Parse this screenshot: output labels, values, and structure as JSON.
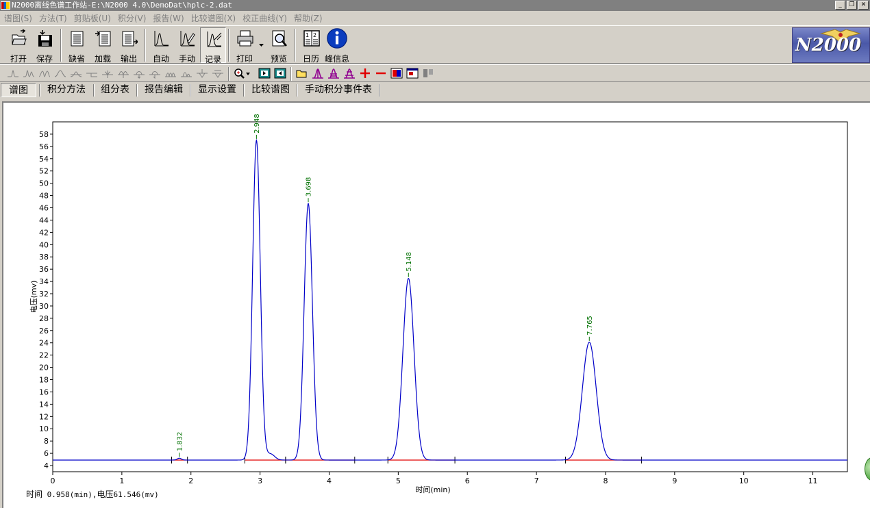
{
  "window": {
    "title": "N2000离线色谱工作站-E:\\N2000 4.0\\DemoDat\\hplc-2.dat",
    "min_glyph": "_",
    "restore_glyph": "❐",
    "close_glyph": "✕"
  },
  "menu": [
    "谱图(S)",
    "方法(T)",
    "剪贴板(U)",
    "积分(V)",
    "报告(W)",
    "比较谱图(X)",
    "校正曲线(Y)",
    "帮助(Z)"
  ],
  "toolbar": {
    "open": "打开",
    "save": "保存",
    "default": "缺省",
    "load": "加载",
    "export": "输出",
    "auto": "自动",
    "manual": "手动",
    "record": "记录",
    "print": "打印",
    "preview": "预览",
    "calendar": "日历",
    "peak_info": "峰信息"
  },
  "logo": "N2000",
  "tabs": [
    "谱图",
    "积分方法",
    "组分表",
    "报告编辑",
    "显示设置",
    "比较谱图",
    "手动积分事件表"
  ],
  "status": {
    "time_label": "时间",
    "time_value": " 0.958(min),",
    "voltage_label": "电压",
    "voltage_value": "61.546(mv)"
  },
  "colors": {
    "trace": "#0000c8",
    "baseline": "#e00000",
    "peak_label": "#007000",
    "axis": "#000000"
  },
  "chart_data": {
    "type": "line",
    "xlabel": "时间(min)",
    "ylabel": "电压(mv)",
    "xlim": [
      0,
      11.5
    ],
    "ylim": [
      3,
      60
    ],
    "x_ticks": [
      0,
      1,
      2,
      3,
      4,
      5,
      6,
      7,
      8,
      9,
      10,
      11
    ],
    "y_ticks": [
      4,
      6,
      8,
      10,
      12,
      14,
      16,
      18,
      20,
      22,
      24,
      26,
      28,
      30,
      32,
      34,
      36,
      38,
      40,
      42,
      44,
      46,
      48,
      50,
      52,
      54,
      56,
      58
    ],
    "baseline_mv": 4.9,
    "peaks": [
      {
        "rt": 1.832,
        "label": "1.832",
        "height_mv": 5.2,
        "width": 0.03,
        "start": 1.72,
        "end": 1.95
      },
      {
        "rt": 2.948,
        "label": "2.948",
        "height_mv": 57.0,
        "width": 0.055,
        "start": 2.78,
        "end": 3.37
      },
      {
        "rt": 3.698,
        "label": "3.698",
        "height_mv": 46.7,
        "width": 0.06,
        "start": 3.37,
        "end": 4.37
      },
      {
        "rt": 5.148,
        "label": "5.148",
        "height_mv": 34.5,
        "width": 0.08,
        "start": 4.85,
        "end": 5.82
      },
      {
        "rt": 7.765,
        "label": "7.765",
        "height_mv": 24.1,
        "width": 0.1,
        "start": 7.42,
        "end": 8.52
      }
    ],
    "shoulder": {
      "rt": 3.15,
      "height_mv": 5.9,
      "width": 0.06
    }
  }
}
